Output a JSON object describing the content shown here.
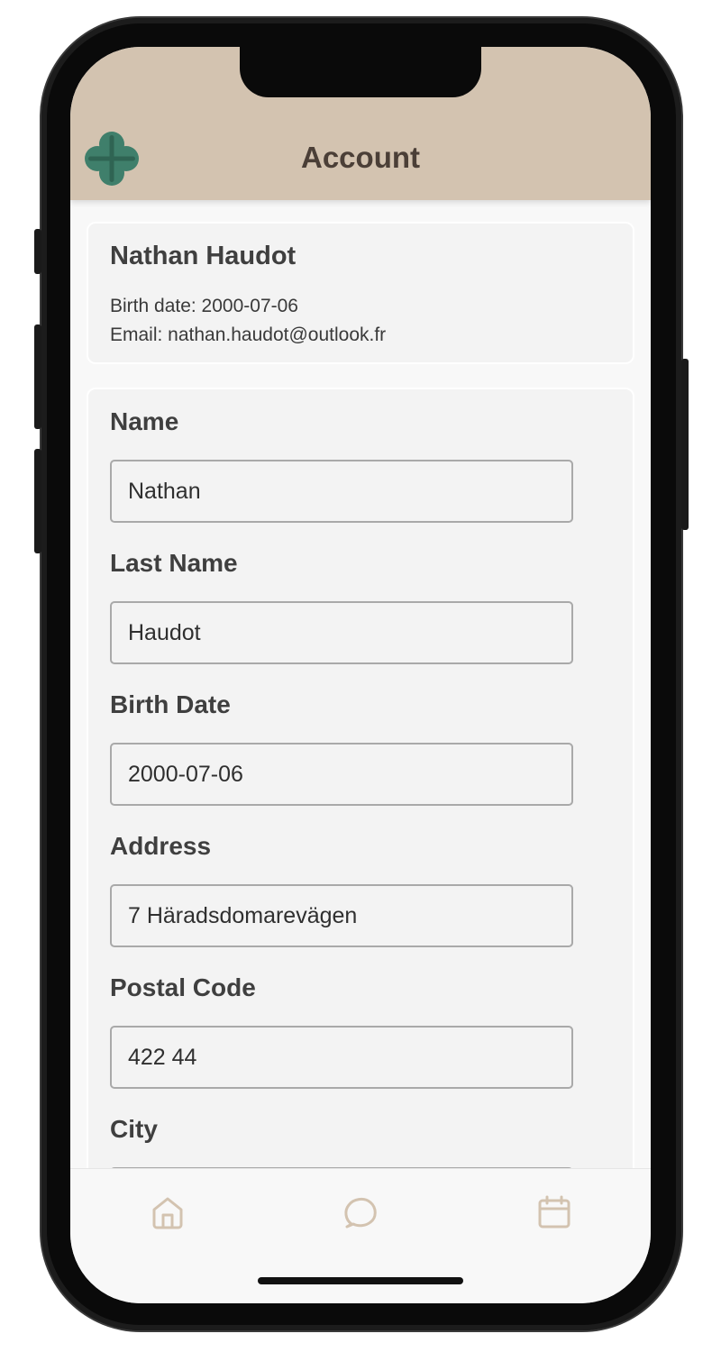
{
  "header": {
    "title": "Account",
    "logo_icon": "clover-icon",
    "background": "#d3c3b0",
    "logo_color": "#3f7f6b"
  },
  "profile": {
    "name": "Nathan Haudot",
    "birth_line": "Birth date: 2000-07-06",
    "email_line": "Email: nathan.haudot@outlook.fr"
  },
  "form": {
    "fields": [
      {
        "label": "Name",
        "value": "Nathan"
      },
      {
        "label": "Last Name",
        "value": "Haudot"
      },
      {
        "label": "Birth Date",
        "value": "2000-07-06"
      },
      {
        "label": "Address",
        "value": "7 Häradsdomarevägen"
      },
      {
        "label": "Postal Code",
        "value": "422 44"
      },
      {
        "label": "City",
        "value": ""
      }
    ]
  },
  "tabbar": {
    "items": [
      {
        "icon": "home-icon"
      },
      {
        "icon": "chat-icon"
      },
      {
        "icon": "calendar-icon"
      }
    ],
    "icon_color": "#d3c3b0"
  }
}
